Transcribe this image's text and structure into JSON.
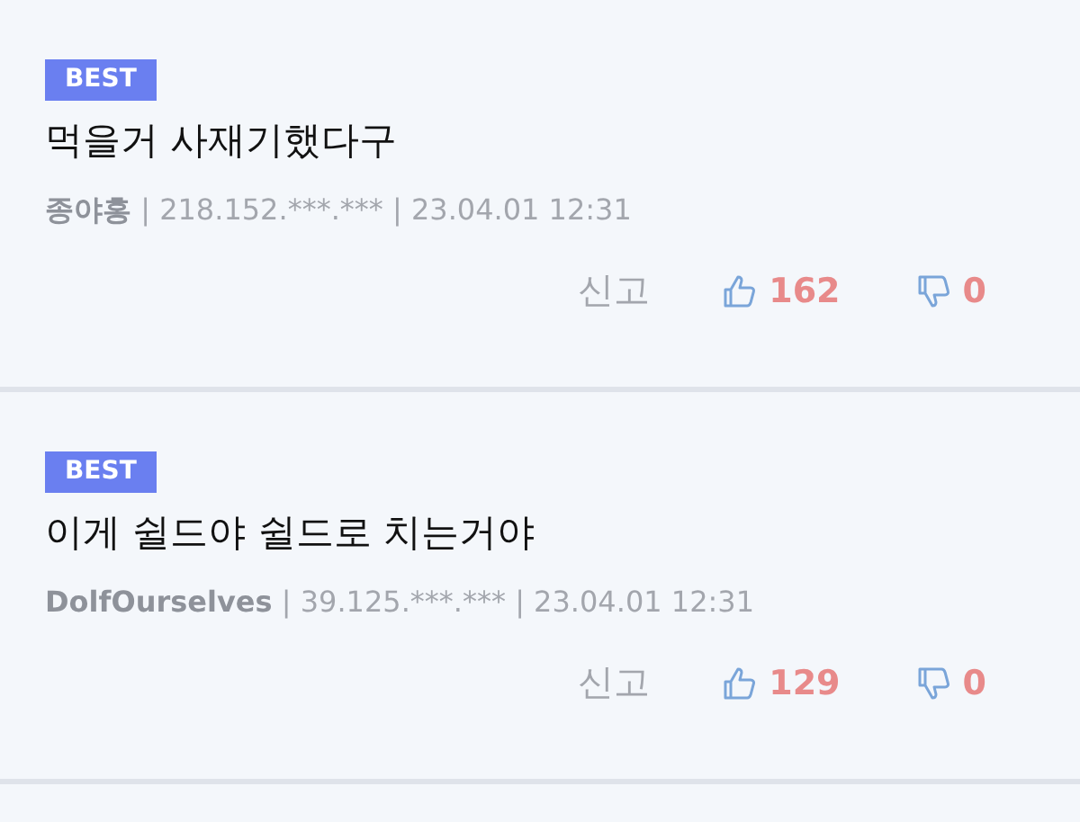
{
  "comments": [
    {
      "badge": "BEST",
      "text": "먹을거 사재기했다구",
      "author": "종야홍",
      "info": "| 218.152.***.*** | 23.04.01 12:31",
      "report": "신고",
      "likes": "162",
      "dislikes": "0"
    },
    {
      "badge": "BEST",
      "text": "이게 쉴드야 쉴드로 치는거야",
      "author": "DolfOurselves",
      "info": "| 39.125.***.*** | 23.04.01 12:31",
      "report": "신고",
      "likes": "129",
      "dislikes": "0"
    }
  ]
}
